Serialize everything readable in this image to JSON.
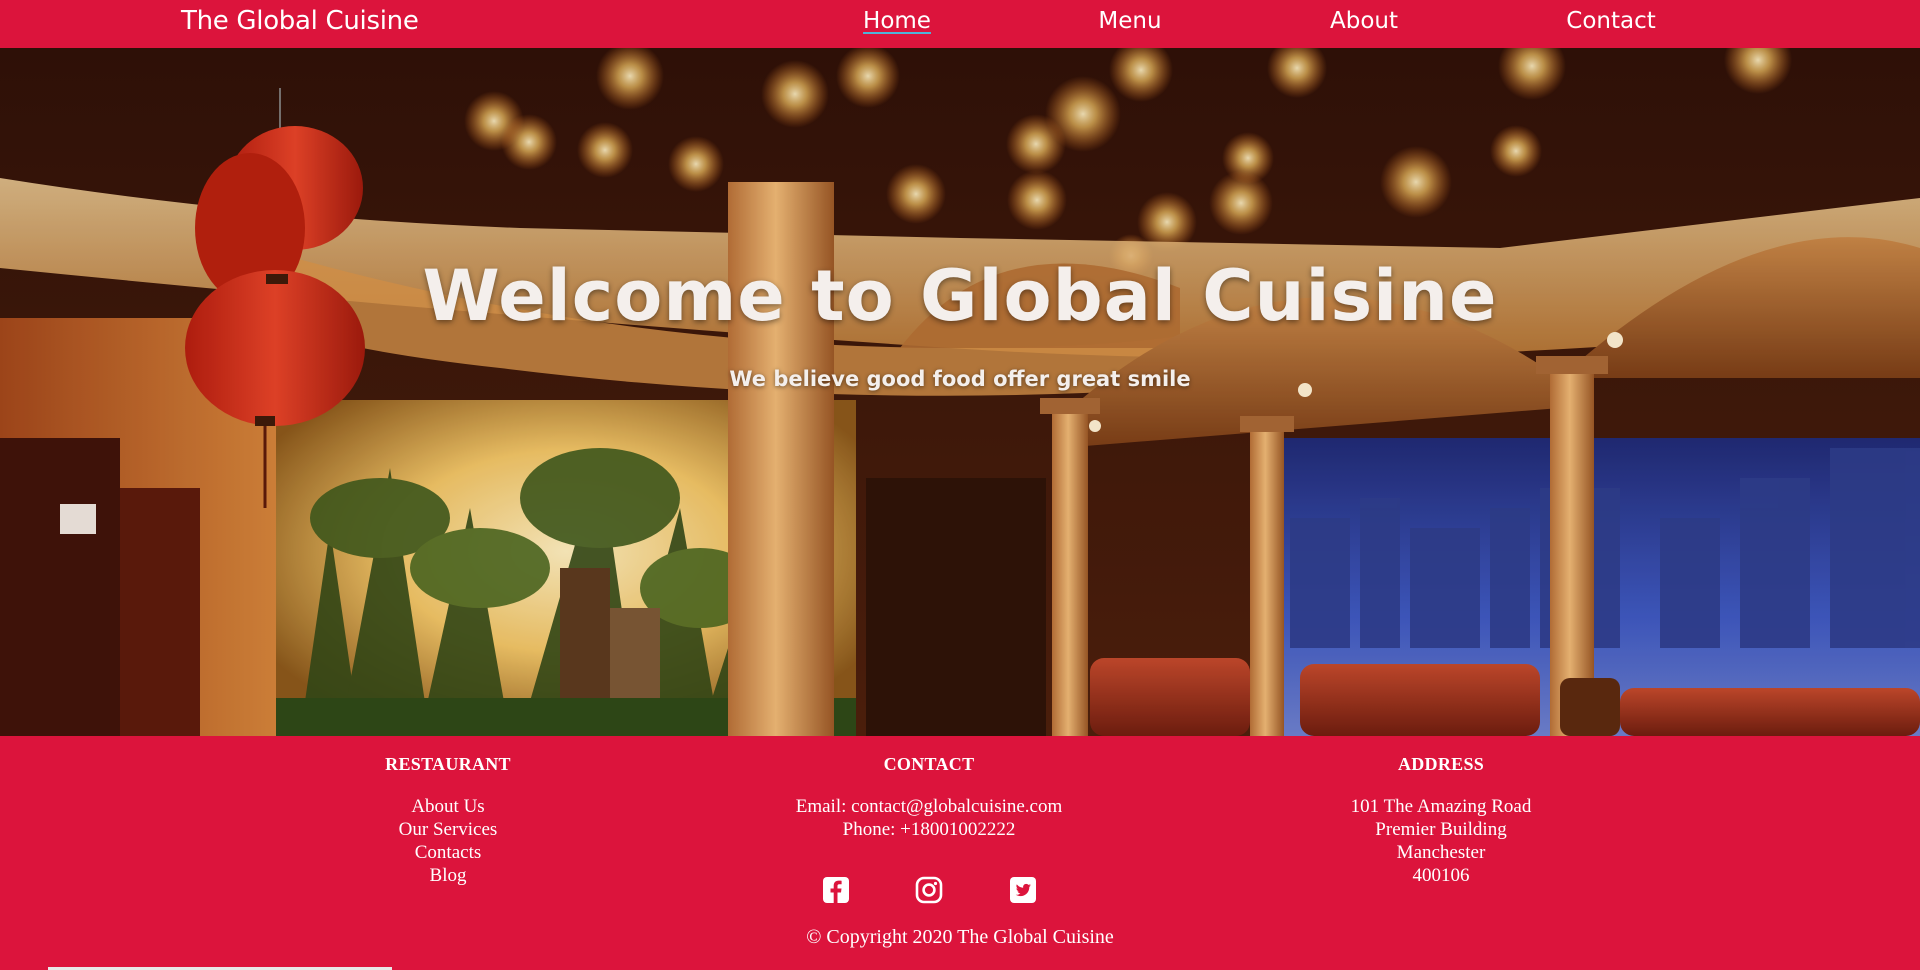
{
  "colors": {
    "brand_red": "#dc143c",
    "text": "#ffffff",
    "active_underline": "#4fb3d9"
  },
  "navbar": {
    "brand": "The Global Cuisine",
    "links": [
      {
        "label": "Home",
        "active": true
      },
      {
        "label": "Menu",
        "active": false
      },
      {
        "label": "About",
        "active": false
      },
      {
        "label": "Contact",
        "active": false
      }
    ]
  },
  "hero": {
    "title": "Welcome to Global Cuisine",
    "subtitle": "We believe good food offer great smile"
  },
  "footer": {
    "restaurant": {
      "heading": "RESTAURANT",
      "links": [
        "About Us",
        "Our Services",
        "Contacts",
        "Blog"
      ]
    },
    "contact": {
      "heading": "CONTACT",
      "email_line": "Email: contact@globalcuisine.com",
      "phone_line": "Phone: +18001002222",
      "socials": [
        "facebook-icon",
        "instagram-icon",
        "twitter-icon"
      ]
    },
    "address": {
      "heading": "ADDRESS",
      "lines": [
        "101 The Amazing Road",
        "Premier Building",
        "Manchester",
        "400106"
      ]
    },
    "copyright": "© Copyright 2020 The Global Cuisine"
  }
}
